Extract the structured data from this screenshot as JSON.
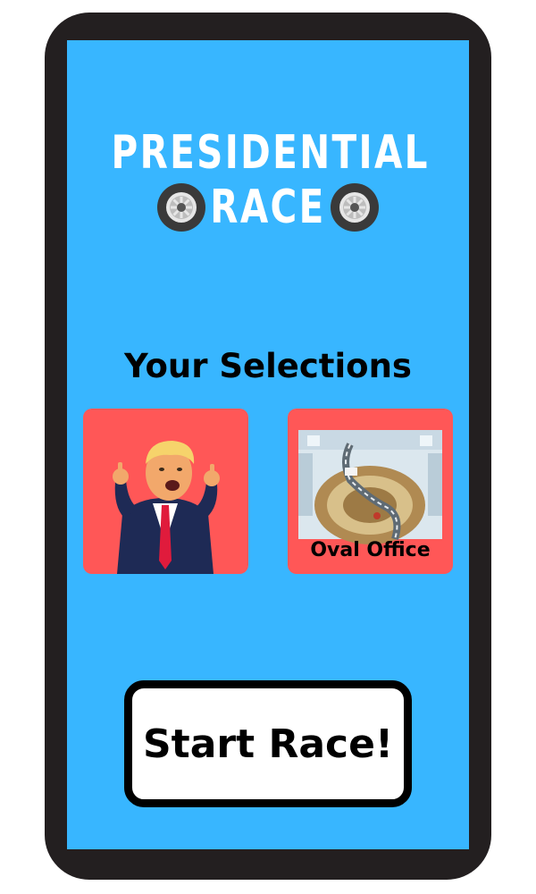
{
  "app": {
    "logo_line1": "PRESIDENTIAL",
    "logo_line2": "RACE"
  },
  "selections": {
    "heading": "Your Selections",
    "character": {
      "icon": "cartoon-president-character-image"
    },
    "track": {
      "label": "Oval Office",
      "icon": "oval-office-track-image"
    }
  },
  "start_button": {
    "label": "Start Race!"
  },
  "colors": {
    "screen_background": "#38b6ff",
    "card_background": "#ff5757",
    "phone_frame": "#231f20",
    "logo_text": "#ffffff"
  }
}
